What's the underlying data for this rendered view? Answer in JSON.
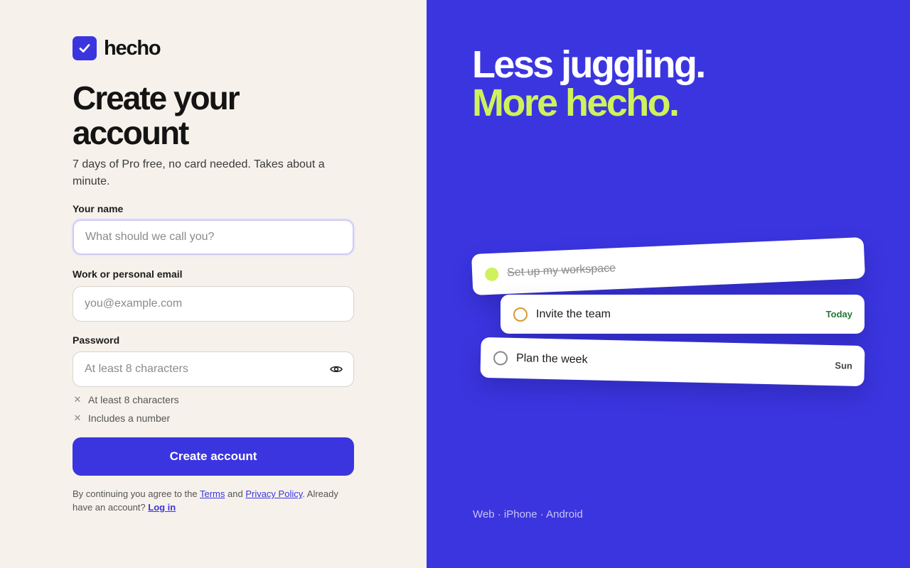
{
  "brand": {
    "name": "hecho",
    "logo_icon": "checkmark-icon",
    "accent": "#3b35e0"
  },
  "form": {
    "title": "Create your account",
    "subtitle": "7 days of Pro free, no card needed. Takes about a minute.",
    "name_label": "Your name",
    "name_placeholder": "What should we call you?",
    "name_value": "",
    "email_label": "Work or personal email",
    "email_placeholder": "you@example.com",
    "email_value": "",
    "password_label": "Password",
    "password_placeholder": "At least 8 characters",
    "password_value": "",
    "rules": [
      {
        "text": "At least 8 characters",
        "met": false
      },
      {
        "text": "Includes a number",
        "met": false
      }
    ],
    "submit_label": "Create account",
    "legal": {
      "prefix": "By continuing you agree to the ",
      "terms": "Terms",
      "and": " and ",
      "privacy": "Privacy Policy",
      "suffix": ". Already have an account? ",
      "login": "Log in"
    }
  },
  "promo": {
    "line1": "Less juggling.",
    "line2": "More hecho.",
    "line1_color": "#ffffff",
    "line2_color": "#cff25c",
    "background": "#3b35e0",
    "tasks": [
      {
        "text": "Set up my workspace",
        "meta": "",
        "done": true
      },
      {
        "text": "Invite the team",
        "meta": "Today",
        "done": false,
        "meta_color": "#1f7a33"
      },
      {
        "text": "Plan the week",
        "meta": "Sun",
        "done": false,
        "meta_color": "#444444"
      }
    ],
    "platforms": "Web · iPhone · Android"
  }
}
